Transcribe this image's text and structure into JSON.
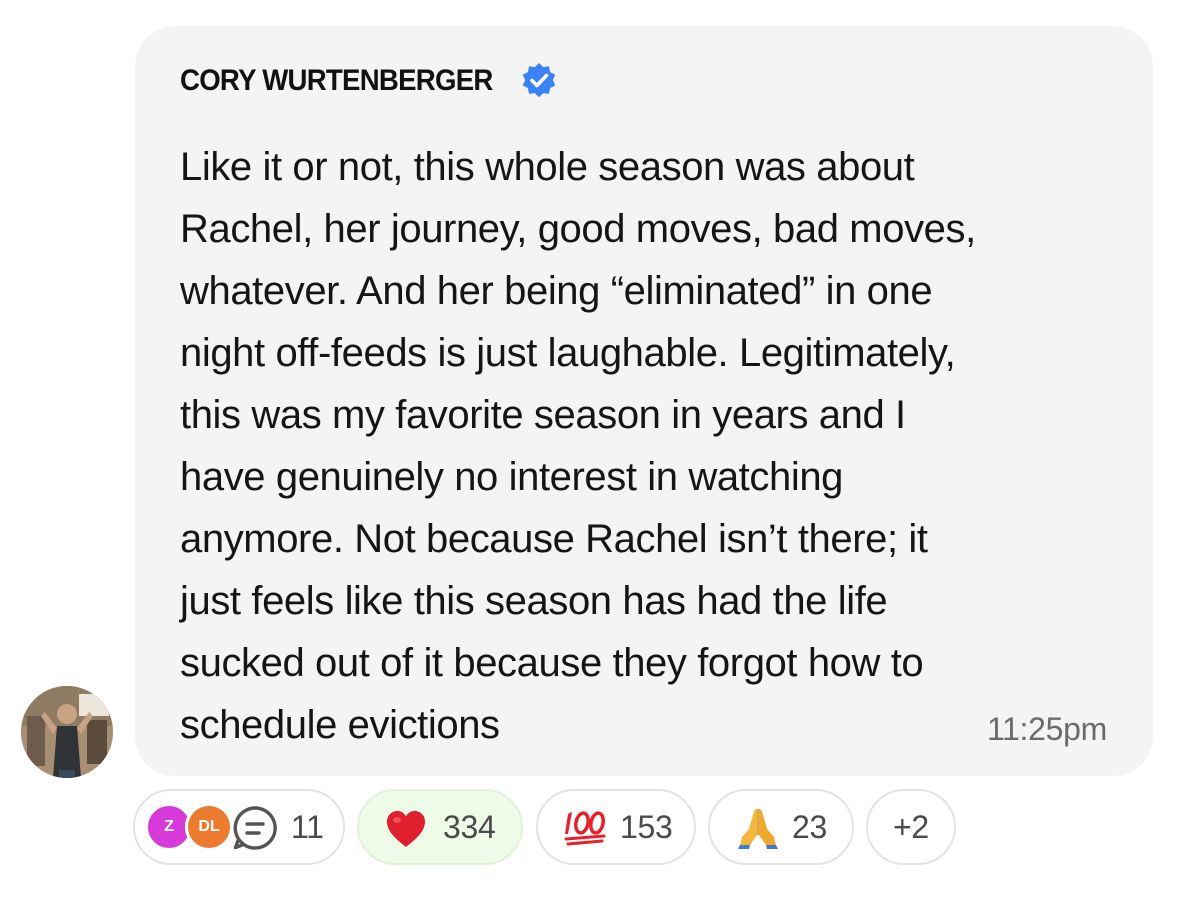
{
  "message": {
    "author": "CORY WURTENBERGER",
    "verified_icon": "verified-badge-icon",
    "body_lines": [
      "Like it or not, this whole season was about",
      "Rachel, her journey, good moves, bad moves,",
      "whatever. And her being “eliminated” in one",
      "night off-feeds is just laughable. Legitimately,",
      "this was my favorite season in years and I",
      "have genuinely no interest in watching",
      "anymore. Not because Rachel isn’t there; it",
      "just feels like this season has had the life",
      "sucked out of it because they forgot how to",
      "schedule evictions"
    ],
    "timestamp": "11:25pm",
    "sender_avatar": "user-avatar-photo"
  },
  "reactions": {
    "replies": {
      "avatars": [
        {
          "initials": "Z",
          "color": "#d63ad8"
        },
        {
          "initials": "DL",
          "color": "#ec7a2f"
        }
      ],
      "icon": "reply-bubble-icon",
      "count": "11"
    },
    "items": [
      {
        "emoji": "❤️",
        "icon": "heart-icon",
        "count": "334",
        "selected": true
      },
      {
        "emoji": "💯",
        "icon": "hundred-points-icon",
        "count": "153",
        "selected": false
      },
      {
        "emoji": "🙏",
        "icon": "folded-hands-icon",
        "count": "23",
        "selected": false
      }
    ],
    "more": "+2"
  },
  "colors": {
    "bubble_bg": "#f4f4f4",
    "verified_blue": "#3b82f6",
    "selected_pill_bg": "#effbe9",
    "text": "#151515",
    "muted_text": "#6b6b6b"
  }
}
